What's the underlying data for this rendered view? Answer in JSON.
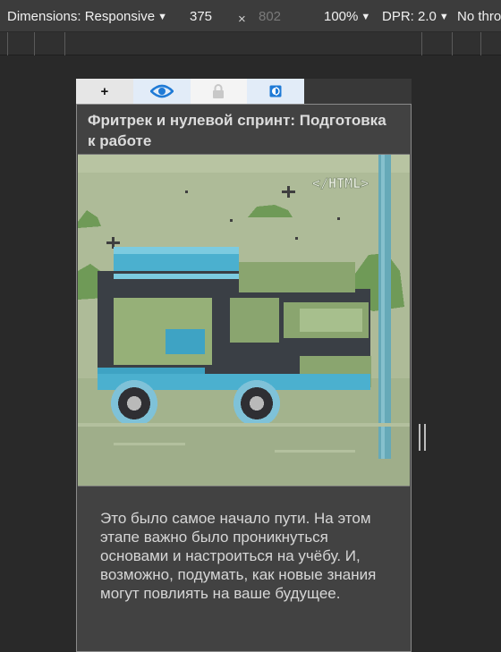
{
  "toolbar": {
    "dimensions_label": "Dimensions: Responsive",
    "width_value": "375",
    "separator": "×",
    "height_value": "802",
    "zoom": "100%",
    "dpr": "DPR: 2.0",
    "throttling": "No thro"
  },
  "viewport": {
    "tabs": [
      {
        "icon": "plus-icon",
        "label": "+"
      },
      {
        "icon": "eye-icon"
      },
      {
        "icon": "lock-icon"
      },
      {
        "icon": "contrast-icon"
      }
    ],
    "card": {
      "title": "Фритрек и нулевой спринт: Подготовка к работе",
      "image_badge": "</HTML>",
      "text": "Это было самое начало пути. На этом этапе важно было проникнуться основами и настроиться на учёбу. И, возможно, подумать, как новые знания могут повлиять на ваше будущее."
    }
  },
  "colors": {
    "accent_blue": "#1f7ad6",
    "van_blue": "#3ea3c4",
    "image_bg": "#a9b993"
  }
}
